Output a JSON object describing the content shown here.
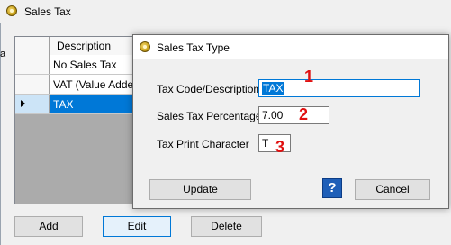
{
  "main_window": {
    "title": "Sales Tax",
    "left_mark": "a",
    "grid": {
      "column_header": "Description",
      "rows": [
        {
          "description": "No Sales Tax",
          "selected": false
        },
        {
          "description": "VAT (Value Added",
          "selected": false
        },
        {
          "description": "TAX",
          "selected": true
        }
      ]
    },
    "buttons": {
      "add": "Add",
      "edit": "Edit",
      "delete": "Delete"
    }
  },
  "dialog": {
    "title": "Sales Tax Type",
    "fields": {
      "tax_code_label": "Tax Code/Description",
      "tax_code_value": "TAX",
      "percentage_label": "Sales Tax Percentage",
      "percentage_value": "7.00",
      "print_char_label": "Tax Print Character",
      "print_char_value": "T"
    },
    "markers": {
      "one": "1",
      "two": "2",
      "three": "3"
    },
    "buttons": {
      "update": "Update",
      "help": "?",
      "cancel": "Cancel"
    }
  },
  "colors": {
    "selection": "#0078d7",
    "marker": "#e01010",
    "help_button": "#1f5fb8"
  },
  "icons": {
    "app": "coin-icon",
    "row_indicator": "triangle-right-icon"
  }
}
